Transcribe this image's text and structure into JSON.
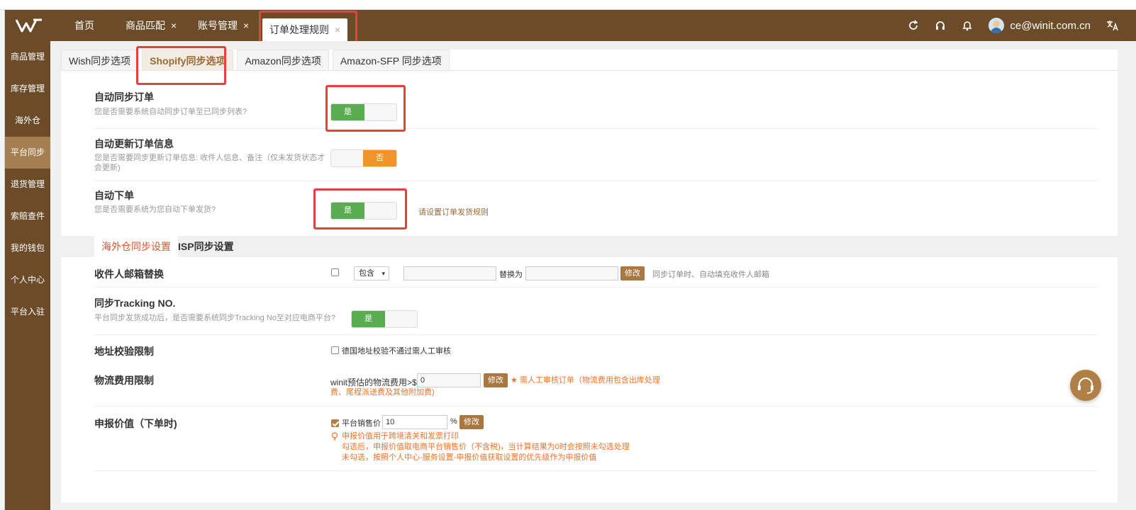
{
  "topbar": {
    "tabs": [
      {
        "label": "首页",
        "closable": false
      },
      {
        "label": "商品匹配",
        "closable": true
      },
      {
        "label": "账号管理",
        "closable": true
      },
      {
        "label": "订单处理规则",
        "closable": true,
        "active": true
      }
    ],
    "close_glyph": "×",
    "user_email": "ce@winit.com.cn"
  },
  "sidebar": {
    "items": [
      "商品管理",
      "库存管理",
      "海外仓",
      "平台同步",
      "退货管理",
      "索赔查件",
      "我的钱包",
      "个人中心",
      "平台入驻"
    ],
    "active_index": 3
  },
  "subtabs": [
    "Wish同步选项",
    "Shopify同步选项",
    "Amazon同步选项",
    "Amazon-SFP 同步选项"
  ],
  "settings": {
    "auto_sync": {
      "title": "自动同步订单",
      "desc": "您是否需要系统自动同步订单至已同步列表?",
      "on_label": "是"
    },
    "auto_update": {
      "title": "自动更新订单信息",
      "desc": "您是否需要同步更新订单信息: 收件人信息、备注（仅未发货状态才会更新)",
      "off_label": "否"
    },
    "auto_place": {
      "title": "自动下单",
      "desc": "您是否需要系统为您自动下单发货?",
      "on_label": "是",
      "link": "请设置订单发货规则"
    }
  },
  "sync_tabs": [
    "海外仓同步设置",
    "ISP同步设置"
  ],
  "email_replace": {
    "title": "收件人邮箱替换",
    "select_value": "包含",
    "replace_label": "替换为",
    "modify": "修改",
    "note": "同步订单时、自动填充收件人邮箱"
  },
  "tracking": {
    "title": "同步Tracking NO.",
    "desc": "平台同步发货成功后，是否需要系统同步Tracking No至对应电商平台?",
    "on_label": "是"
  },
  "address": {
    "title": "地址校验限制",
    "checkbox_label": "德国地址校验不通过需人工审核"
  },
  "logistics": {
    "title": "物流费用限制",
    "prefix": "winit预估的物流费用>$",
    "value": "0",
    "modify": "修改",
    "warn_line1": "需人工审核订单（物流费用包含出库处理",
    "warn_line2": "费、尾程派送费及其他附加费)"
  },
  "declare": {
    "title": "申报价值（下单时)",
    "checkbox_label": "平台销售价",
    "value": "10",
    "unit": "%",
    "modify": "修改",
    "note1": "申报价值用于跨境清关和发票打印",
    "note2": "勾选后，申报价值取电商平台销售价（不含税)，当计算结果为0时会按照未勾选处理",
    "note3": "未勾选，按照个人中心-服务设置-申报价值获取设置的优先级作为申报价值"
  },
  "colors": {
    "brand": "#6b4b28",
    "toggle_on": "#5aac51",
    "toggle_off": "#f0952b",
    "highlight": "#e8403d",
    "accent": "#a97842"
  }
}
